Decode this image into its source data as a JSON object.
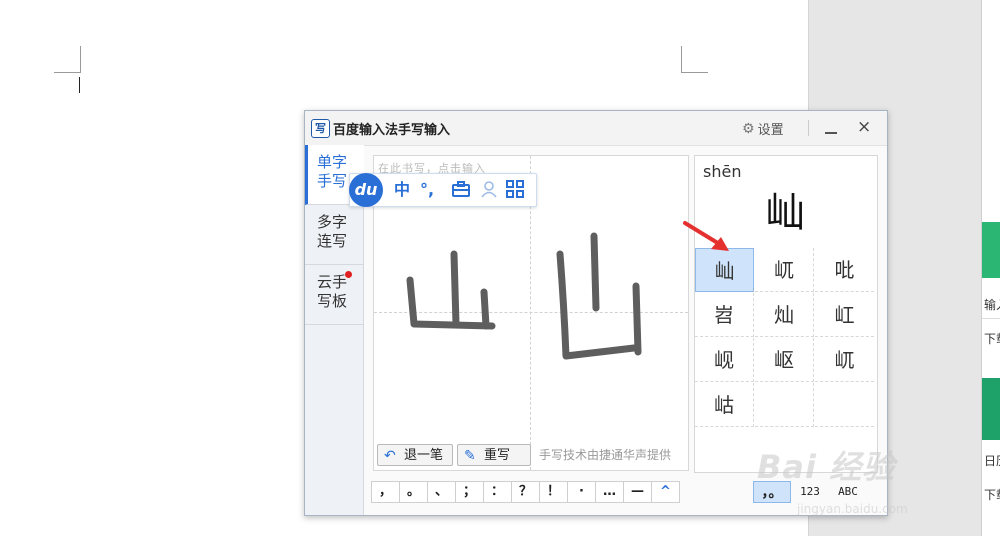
{
  "window": {
    "title": "百度输入法手写输入",
    "settings_label": "设置",
    "close_label": "×"
  },
  "tabs": [
    {
      "label": "单字手写",
      "line1": "单字",
      "line2": "手写"
    },
    {
      "label": "多字连写",
      "line1": "多字",
      "line2": "连写"
    },
    {
      "label": "云手写板",
      "line1": "云手",
      "line2": "写板"
    }
  ],
  "board": {
    "faded_text": "在此书写，点击输入",
    "credit": "手写技术由捷通华声提供",
    "undo_label": "退一笔",
    "rewrite_label": "重写"
  },
  "du_toolbar": {
    "logo": "du",
    "lang": "中",
    "punct": "°,",
    "toolbox_icon": "toolbox-icon",
    "user_icon": "user-icon",
    "grid_icon": "grid-icon"
  },
  "result": {
    "pinyin": "shēn",
    "char": "屾"
  },
  "candidates": [
    "屾",
    "屼",
    "吡",
    "岧",
    "灿",
    "屸",
    "岘",
    "岖",
    "屼",
    "岵",
    "",
    ""
  ],
  "punctuation": [
    "，",
    "。",
    "、",
    "；",
    "：",
    "？",
    "！",
    "·",
    "…",
    "—",
    "^"
  ],
  "modes": [
    "，。",
    "123",
    "ABC"
  ],
  "watermark": {
    "text": "Bai 经验",
    "sub": "jingyan.baidu.com"
  },
  "side": {
    "t1": "输入",
    "t2": "下载",
    "t3": "日历",
    "t4": "下载"
  },
  "colors": {
    "accent": "#2a6fd6",
    "selected": "#cfe4fb",
    "arrow": "#e53030"
  }
}
